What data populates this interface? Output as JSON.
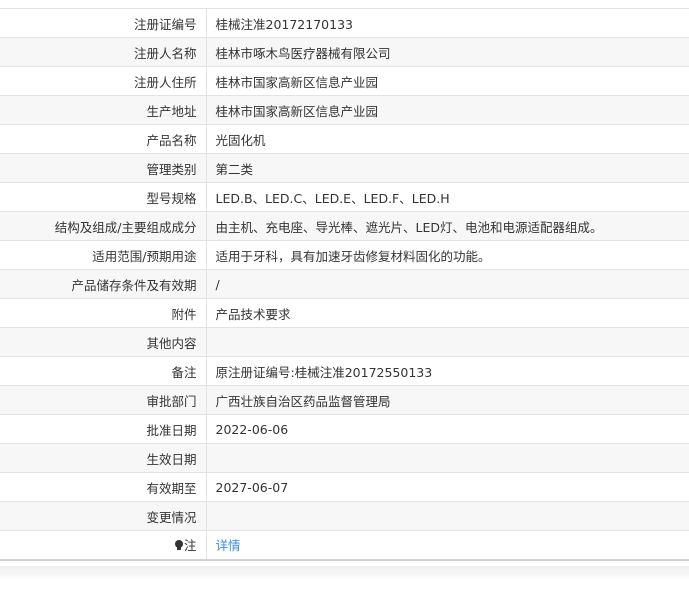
{
  "rows": [
    {
      "label": "注册证编号",
      "value": "桂械注准20172170133"
    },
    {
      "label": "注册人名称",
      "value": "桂林市啄木鸟医疗器械有限公司"
    },
    {
      "label": "注册人住所",
      "value": "桂林市国家高新区信息产业园"
    },
    {
      "label": "生产地址",
      "value": "桂林市国家高新区信息产业园"
    },
    {
      "label": "产品名称",
      "value": "光固化机"
    },
    {
      "label": "管理类别",
      "value": "第二类"
    },
    {
      "label": "型号规格",
      "value": "LED.B、LED.C、LED.E、LED.F、LED.H"
    },
    {
      "label": "结构及组成/主要组成成分",
      "value": "由主机、充电座、导光棒、遮光片、LED灯、电池和电源适配器组成。"
    },
    {
      "label": "适用范围/预期用途",
      "value": "适用于牙科，具有加速牙齿修复材料固化的功能。"
    },
    {
      "label": "产品储存条件及有效期",
      "value": "/"
    },
    {
      "label": "附件",
      "value": "产品技术要求"
    },
    {
      "label": "其他内容",
      "value": ""
    },
    {
      "label": "备注",
      "value": "原注册证编号:桂械注准20172550133"
    },
    {
      "label": "审批部门",
      "value": "广西壮族自治区药品监督管理局"
    },
    {
      "label": "批准日期",
      "value": "2022-06-06"
    },
    {
      "label": "生效日期",
      "value": ""
    },
    {
      "label": "有效期至",
      "value": "2027-06-07"
    },
    {
      "label": "变更情况",
      "value": ""
    }
  ],
  "note": {
    "label": "注",
    "icon": "lightbulb-icon",
    "link_text": "详情",
    "link_color": "#3a8ee6"
  }
}
